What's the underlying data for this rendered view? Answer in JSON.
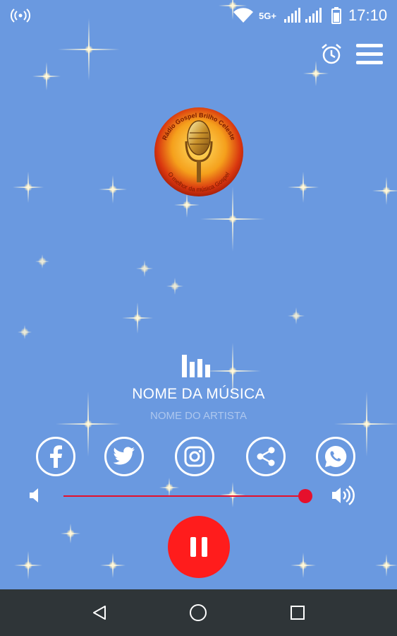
{
  "status_bar": {
    "network_type": "5G+",
    "time": "17:10",
    "icons": [
      "hotspot-icon",
      "wifi-icon",
      "signal-icon",
      "signal-icon",
      "battery-icon"
    ]
  },
  "header": {
    "alarm_icon": "alarm-clock-icon",
    "menu_icon": "hamburger-menu-icon"
  },
  "logo": {
    "top_text": "Rádio Gospel Brilho Celeste",
    "bottom_text": "O melhor da música Gospel"
  },
  "now_playing": {
    "equalizer_icon": "equalizer-icon",
    "song_title": "NOME DA MÚSICA",
    "artist_name": "NOME DO ARTISTA"
  },
  "social": [
    {
      "name": "facebook",
      "icon": "facebook-icon"
    },
    {
      "name": "twitter",
      "icon": "twitter-icon"
    },
    {
      "name": "instagram",
      "icon": "instagram-icon"
    },
    {
      "name": "share",
      "icon": "share-icon"
    },
    {
      "name": "whatsapp",
      "icon": "whatsapp-icon"
    }
  ],
  "volume": {
    "level": 1.0,
    "accent_color": "#e5102c"
  },
  "player": {
    "state": "playing",
    "button_icon": "pause-icon",
    "button_color": "#ff1c1c"
  },
  "nav_bar": {
    "buttons": [
      "back-icon",
      "home-icon",
      "recents-icon"
    ]
  },
  "colors": {
    "background": "#6a99e0",
    "nav_bar": "#2f3538"
  }
}
